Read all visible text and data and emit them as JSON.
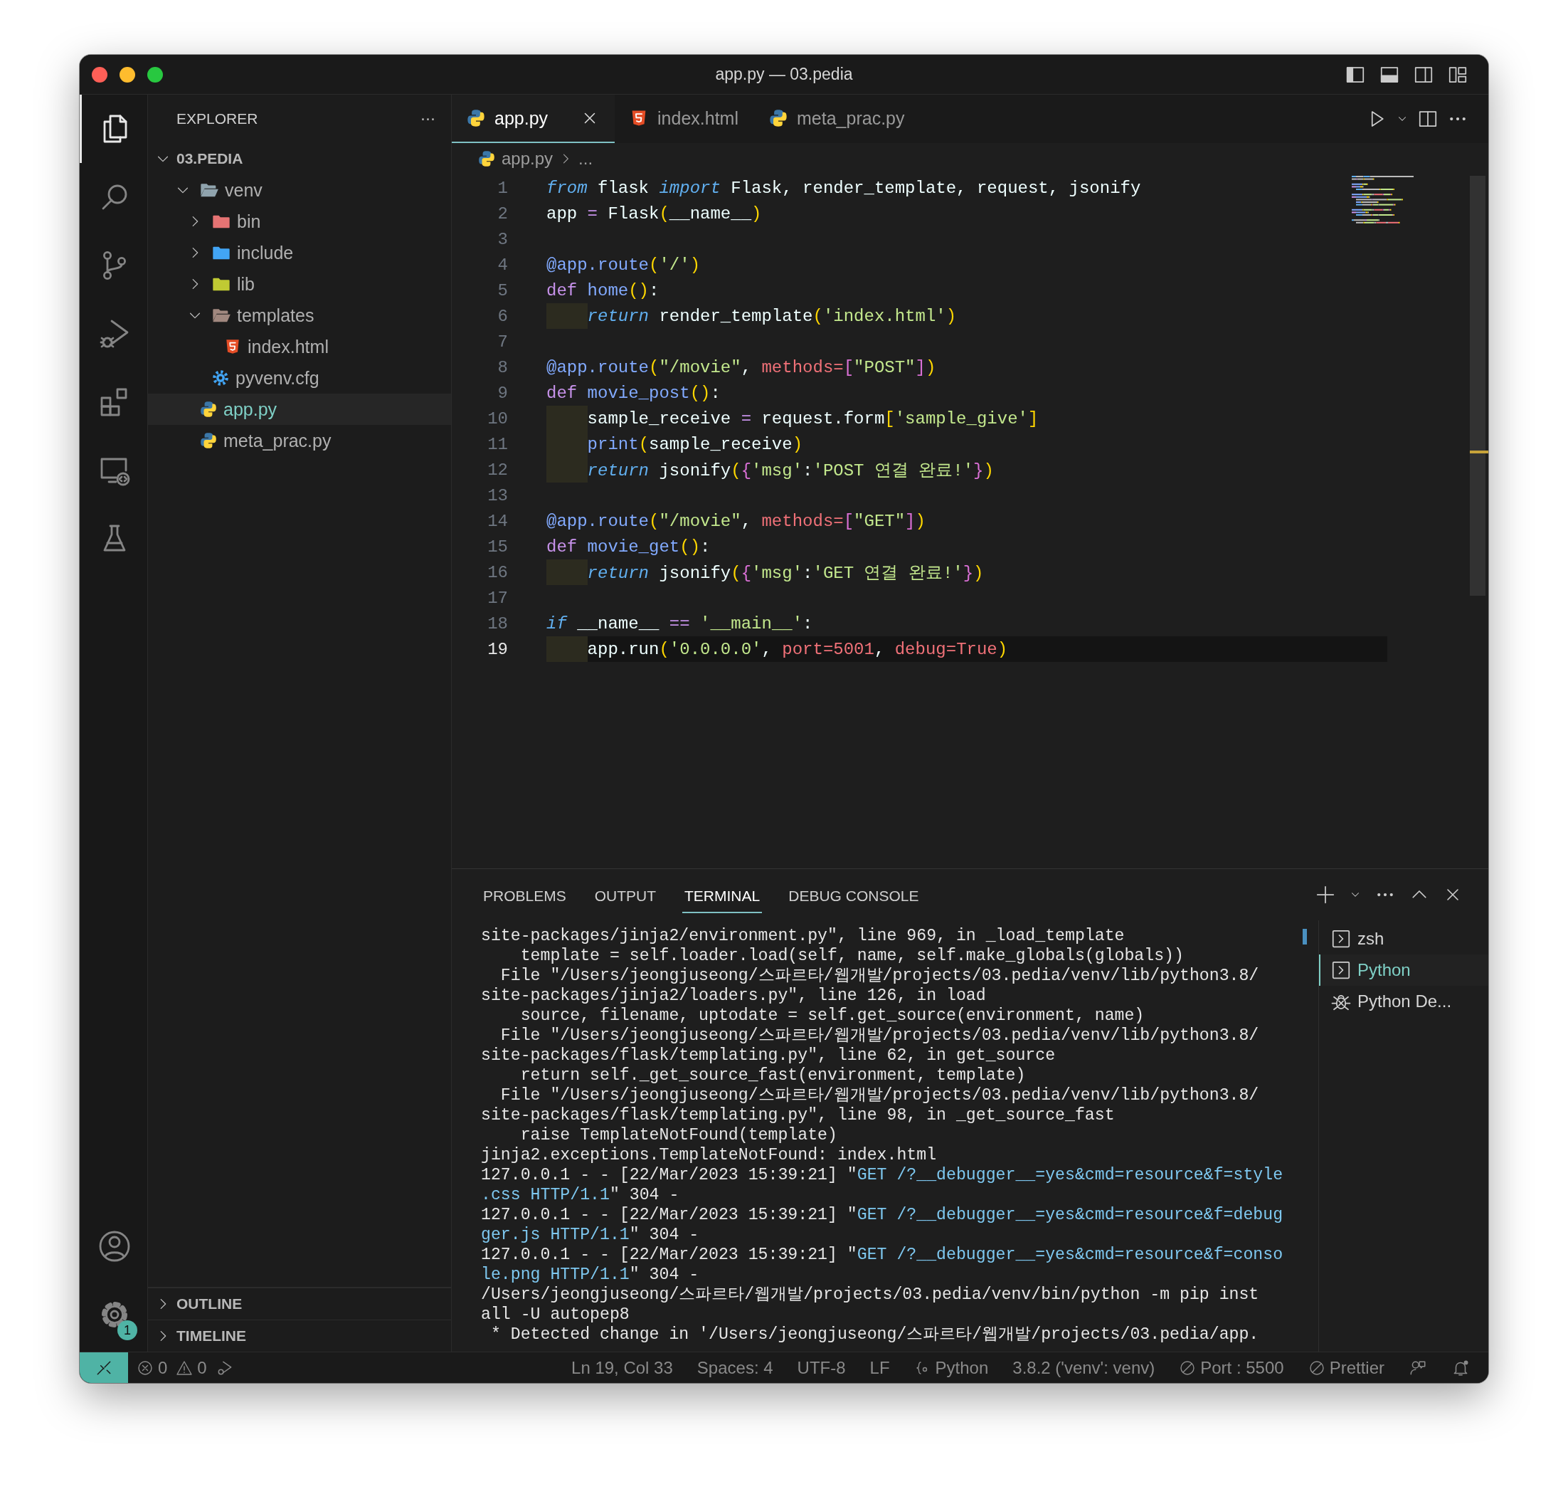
{
  "window": {
    "title": "app.py — 03.pedia"
  },
  "activity_bar": {
    "items": [
      {
        "kind": "explorer",
        "selected": true
      },
      {
        "kind": "search",
        "selected": false
      },
      {
        "kind": "source-control",
        "selected": false
      },
      {
        "kind": "run-debug",
        "selected": false
      },
      {
        "kind": "extensions",
        "selected": false
      },
      {
        "kind": "remote",
        "selected": false
      },
      {
        "kind": "testing",
        "selected": false
      }
    ],
    "bottom": [
      {
        "kind": "account"
      },
      {
        "kind": "settings",
        "badge": "1"
      }
    ]
  },
  "sidebar": {
    "title": "EXPLORER",
    "more": "···",
    "section": {
      "label": "03.PEDIA",
      "expanded": true
    },
    "tree": [
      {
        "label": "venv",
        "kind": "folder",
        "color": "#90a4ae",
        "expanded": true,
        "selected": false,
        "children": [
          {
            "label": "bin",
            "kind": "folder",
            "color": "#e57373",
            "expanded": false,
            "selected": false
          },
          {
            "label": "include",
            "kind": "folder",
            "color": "#42a5f5",
            "expanded": false,
            "selected": false
          },
          {
            "label": "lib",
            "kind": "folder",
            "color": "#c0ca33",
            "expanded": false,
            "selected": false
          },
          {
            "label": "templates",
            "kind": "folder",
            "color": "#a1887f",
            "expanded": true,
            "selected": false,
            "children": [
              {
                "label": "index.html",
                "kind": "html",
                "selected": false
              }
            ]
          },
          {
            "label": "pyvenv.cfg",
            "kind": "config",
            "selected": false
          }
        ]
      },
      {
        "label": "app.py",
        "kind": "python",
        "selected": true
      },
      {
        "label": "meta_prac.py",
        "kind": "python",
        "selected": false
      }
    ],
    "collapsed_sections": [
      {
        "label": "OUTLINE",
        "expanded": false
      },
      {
        "label": "TIMELINE",
        "expanded": false
      }
    ]
  },
  "editor": {
    "tabs": [
      {
        "label": "app.py",
        "kind": "python",
        "selected": true
      },
      {
        "label": "index.html",
        "kind": "html",
        "selected": false
      },
      {
        "label": "meta_prac.py",
        "kind": "python",
        "selected": false
      }
    ],
    "breadcrumb": {
      "file": "app.py",
      "more": "..."
    },
    "lines": [
      {
        "n": "1",
        "indent": false,
        "current": false,
        "tokens": [
          {
            "kind": "kw",
            "text": "from"
          },
          {
            "kind": "plain",
            "text": " flask "
          },
          {
            "kind": "kw",
            "text": "import"
          },
          {
            "kind": "plain",
            "text": " Flask, render_template, request, jsonify"
          }
        ]
      },
      {
        "n": "2",
        "indent": false,
        "current": false,
        "tokens": [
          {
            "kind": "plain",
            "text": "app "
          },
          {
            "kind": "op",
            "text": "="
          },
          {
            "kind": "plain",
            "text": " Flask"
          },
          {
            "kind": "br1",
            "text": "("
          },
          {
            "kind": "plain",
            "text": "__name__"
          },
          {
            "kind": "br1",
            "text": ")"
          }
        ]
      },
      {
        "n": "3",
        "indent": false,
        "current": false
      },
      {
        "n": "4",
        "indent": false,
        "current": false,
        "tokens": [
          {
            "kind": "deco",
            "text": "@app.route"
          },
          {
            "kind": "br1",
            "text": "("
          },
          {
            "kind": "str",
            "text": "'/'"
          },
          {
            "kind": "br1",
            "text": ")"
          }
        ]
      },
      {
        "n": "5",
        "indent": false,
        "current": false,
        "tokens": [
          {
            "kind": "def",
            "text": "def "
          },
          {
            "kind": "fn",
            "text": "home"
          },
          {
            "kind": "br1",
            "text": "()"
          },
          {
            "kind": "plain",
            "text": ":"
          }
        ]
      },
      {
        "n": "6",
        "indent": true,
        "current": false,
        "tokens": [
          {
            "kind": "kw",
            "text": "return"
          },
          {
            "kind": "plain",
            "text": " render_template"
          },
          {
            "kind": "br1",
            "text": "("
          },
          {
            "kind": "str",
            "text": "'index.html'"
          },
          {
            "kind": "br1",
            "text": ")"
          }
        ]
      },
      {
        "n": "7",
        "indent": false,
        "current": false
      },
      {
        "n": "8",
        "indent": false,
        "current": false,
        "tokens": [
          {
            "kind": "deco",
            "text": "@app.route"
          },
          {
            "kind": "br1",
            "text": "("
          },
          {
            "kind": "str",
            "text": "\"/movie\""
          },
          {
            "kind": "plain",
            "text": ", "
          },
          {
            "kind": "param",
            "text": "methods="
          },
          {
            "kind": "br2",
            "text": "["
          },
          {
            "kind": "str",
            "text": "\"POST\""
          },
          {
            "kind": "br2",
            "text": "]"
          },
          {
            "kind": "br1",
            "text": ")"
          }
        ]
      },
      {
        "n": "9",
        "indent": false,
        "current": false,
        "tokens": [
          {
            "kind": "def",
            "text": "def "
          },
          {
            "kind": "fn",
            "text": "movie_post"
          },
          {
            "kind": "br1",
            "text": "()"
          },
          {
            "kind": "plain",
            "text": ":"
          }
        ]
      },
      {
        "n": "10",
        "indent": true,
        "current": false,
        "tokens": [
          {
            "kind": "plain",
            "text": "sample_receive "
          },
          {
            "kind": "op",
            "text": "="
          },
          {
            "kind": "plain",
            "text": " request.form"
          },
          {
            "kind": "br1",
            "text": "["
          },
          {
            "kind": "str",
            "text": "'sample_give'"
          },
          {
            "kind": "br1",
            "text": "]"
          }
        ]
      },
      {
        "n": "11",
        "indent": true,
        "current": false,
        "tokens": [
          {
            "kind": "fn",
            "text": "print"
          },
          {
            "kind": "br1",
            "text": "("
          },
          {
            "kind": "plain",
            "text": "sample_receive"
          },
          {
            "kind": "br1",
            "text": ")"
          }
        ]
      },
      {
        "n": "12",
        "indent": true,
        "current": false,
        "tokens": [
          {
            "kind": "kw",
            "text": "return"
          },
          {
            "kind": "plain",
            "text": " jsonify"
          },
          {
            "kind": "br1",
            "text": "("
          },
          {
            "kind": "br2",
            "text": "{"
          },
          {
            "kind": "str",
            "text": "'msg'"
          },
          {
            "kind": "plain",
            "text": ":"
          },
          {
            "kind": "str",
            "text": "'POST 연결 완료!'"
          },
          {
            "kind": "br2",
            "text": "}"
          },
          {
            "kind": "br1",
            "text": ")"
          }
        ]
      },
      {
        "n": "13",
        "indent": false,
        "current": false
      },
      {
        "n": "14",
        "indent": false,
        "current": false,
        "tokens": [
          {
            "kind": "deco",
            "text": "@app.route"
          },
          {
            "kind": "br1",
            "text": "("
          },
          {
            "kind": "str",
            "text": "\"/movie\""
          },
          {
            "kind": "plain",
            "text": ", "
          },
          {
            "kind": "param",
            "text": "methods="
          },
          {
            "kind": "br2",
            "text": "["
          },
          {
            "kind": "str",
            "text": "\"GET\""
          },
          {
            "kind": "br2",
            "text": "]"
          },
          {
            "kind": "br1",
            "text": ")"
          }
        ]
      },
      {
        "n": "15",
        "indent": false,
        "current": false,
        "tokens": [
          {
            "kind": "def",
            "text": "def "
          },
          {
            "kind": "fn",
            "text": "movie_get"
          },
          {
            "kind": "br1",
            "text": "()"
          },
          {
            "kind": "plain",
            "text": ":"
          }
        ]
      },
      {
        "n": "16",
        "indent": true,
        "current": false,
        "tokens": [
          {
            "kind": "kw",
            "text": "return"
          },
          {
            "kind": "plain",
            "text": " jsonify"
          },
          {
            "kind": "br1",
            "text": "("
          },
          {
            "kind": "br2",
            "text": "{"
          },
          {
            "kind": "str",
            "text": "'msg'"
          },
          {
            "kind": "plain",
            "text": ":"
          },
          {
            "kind": "str",
            "text": "'GET 연결 완료!'"
          },
          {
            "kind": "br2",
            "text": "}"
          },
          {
            "kind": "br1",
            "text": ")"
          }
        ]
      },
      {
        "n": "17",
        "indent": false,
        "current": false
      },
      {
        "n": "18",
        "indent": false,
        "current": false,
        "tokens": [
          {
            "kind": "kw",
            "text": "if"
          },
          {
            "kind": "plain",
            "text": " __name__ "
          },
          {
            "kind": "op",
            "text": "=="
          },
          {
            "kind": "str",
            "text": " '__main__'"
          },
          {
            "kind": "plain",
            "text": ":"
          }
        ]
      },
      {
        "n": "19",
        "indent": true,
        "current": true,
        "tokens": [
          {
            "kind": "plain",
            "text": "app.run"
          },
          {
            "kind": "br1",
            "text": "("
          },
          {
            "kind": "str",
            "text": "'0.0.0.0'"
          },
          {
            "kind": "plain",
            "text": ", "
          },
          {
            "kind": "param",
            "text": "port=5001"
          },
          {
            "kind": "plain",
            "text": ", "
          },
          {
            "kind": "param",
            "text": "debug=True"
          },
          {
            "kind": "br1",
            "text": ")"
          }
        ]
      }
    ]
  },
  "panel": {
    "tabs": [
      {
        "label": "PROBLEMS",
        "selected": false
      },
      {
        "label": "OUTPUT",
        "selected": false
      },
      {
        "label": "TERMINAL",
        "selected": true
      },
      {
        "label": "DEBUG CONSOLE",
        "selected": false
      }
    ],
    "terminal_lines": [
      [
        {
          "kind": "plain",
          "text": "site-packages/jinja2/environment.py\", line 969, in _load_template"
        }
      ],
      [
        {
          "kind": "plain",
          "text": "    template = self.loader.load(self, name, self.make_globals(globals))"
        }
      ],
      [
        {
          "kind": "plain",
          "text": "  File \"/Users/jeongjuseong/스파르타/웹개발/projects/03.pedia/venv/lib/python3.8/"
        }
      ],
      [
        {
          "kind": "plain",
          "text": "site-packages/jinja2/loaders.py\", line 126, in load"
        }
      ],
      [
        {
          "kind": "plain",
          "text": "    source, filename, uptodate = self.get_source(environment, name)"
        }
      ],
      [
        {
          "kind": "plain",
          "text": "  File \"/Users/jeongjuseong/스파르타/웹개발/projects/03.pedia/venv/lib/python3.8/"
        }
      ],
      [
        {
          "kind": "plain",
          "text": "site-packages/flask/templating.py\", line 62, in get_source"
        }
      ],
      [
        {
          "kind": "plain",
          "text": "    return self._get_source_fast(environment, template)"
        }
      ],
      [
        {
          "kind": "plain",
          "text": "  File \"/Users/jeongjuseong/스파르타/웹개발/projects/03.pedia/venv/lib/python3.8/"
        }
      ],
      [
        {
          "kind": "plain",
          "text": "site-packages/flask/templating.py\", line 98, in _get_source_fast"
        }
      ],
      [
        {
          "kind": "plain",
          "text": "    raise TemplateNotFound(template)"
        }
      ],
      [
        {
          "kind": "plain",
          "text": "jinja2.exceptions.TemplateNotFound: index.html"
        }
      ],
      [
        {
          "kind": "plain",
          "text": "127.0.0.1 - - [22/Mar/2023 15:39:21] \""
        },
        {
          "kind": "link",
          "text": "GET /?__debugger__=yes&cmd=resource&f=style"
        }
      ],
      [
        {
          "kind": "link",
          "text": ".css HTTP/1.1"
        },
        {
          "kind": "plain",
          "text": "\" 304 -"
        }
      ],
      [
        {
          "kind": "plain",
          "text": "127.0.0.1 - - [22/Mar/2023 15:39:21] \""
        },
        {
          "kind": "link",
          "text": "GET /?__debugger__=yes&cmd=resource&f=debug"
        }
      ],
      [
        {
          "kind": "link",
          "text": "ger.js HTTP/1.1"
        },
        {
          "kind": "plain",
          "text": "\" 304 -"
        }
      ],
      [
        {
          "kind": "plain",
          "text": "127.0.0.1 - - [22/Mar/2023 15:39:21] \""
        },
        {
          "kind": "link",
          "text": "GET /?__debugger__=yes&cmd=resource&f=conso"
        }
      ],
      [
        {
          "kind": "link",
          "text": "le.png HTTP/1.1"
        },
        {
          "kind": "plain",
          "text": "\" 304 -"
        }
      ],
      [
        {
          "kind": "plain",
          "text": "/Users/jeongjuseong/스파르타/웹개발/projects/03.pedia/venv/bin/python -m pip inst"
        }
      ],
      [
        {
          "kind": "plain",
          "text": "all -U autopep8"
        }
      ],
      [
        {
          "kind": "plain",
          "text": " * Detected change in '/Users/jeongjuseong/스파르타/웹개발/projects/03.pedia/app."
        }
      ]
    ],
    "terminals": [
      {
        "label": "zsh",
        "kind": "shell",
        "selected": false
      },
      {
        "label": "Python",
        "kind": "shell",
        "selected": true
      },
      {
        "label": "Python De...",
        "kind": "debug",
        "selected": false
      }
    ]
  },
  "status_bar": {
    "left": [
      {
        "kind": "errors",
        "text": "0"
      },
      {
        "kind": "warnings",
        "text": "0"
      },
      {
        "kind": "debug"
      }
    ],
    "right": [
      {
        "kind": "text",
        "text": "Ln 19, Col 33"
      },
      {
        "kind": "text",
        "text": "Spaces: 4"
      },
      {
        "kind": "text",
        "text": "UTF-8"
      },
      {
        "kind": "text",
        "text": "LF"
      },
      {
        "kind": "language",
        "text": "Python"
      },
      {
        "kind": "text",
        "text": "3.8.2 ('venv': venv)"
      },
      {
        "kind": "blocked",
        "text": "Port : 5500"
      },
      {
        "kind": "blocked",
        "text": "Prettier"
      },
      {
        "kind": "feedback"
      },
      {
        "kind": "bell"
      }
    ]
  }
}
